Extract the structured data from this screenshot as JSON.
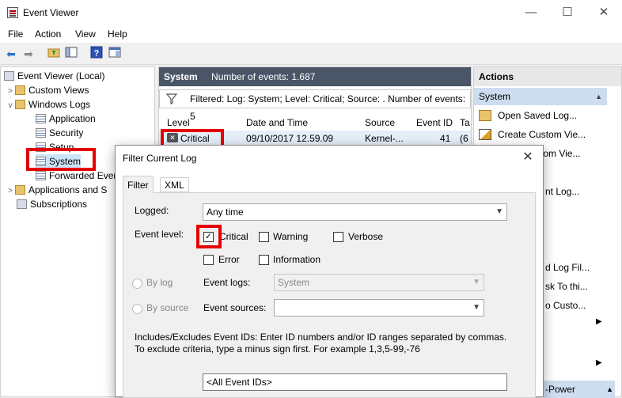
{
  "window": {
    "title": "Event Viewer",
    "minimize": "—",
    "maximize": "☐",
    "close": "✕"
  },
  "menu": [
    "File",
    "Action",
    "View",
    "Help"
  ],
  "toolbar": {
    "back": "back-arrow",
    "forward": "forward-arrow",
    "up": "folder-up",
    "show_hide": "show-hide-tree",
    "help": "help",
    "properties": "properties"
  },
  "tree": {
    "root": "Event Viewer (Local)",
    "custom_views": "Custom Views",
    "windows_logs": "Windows Logs",
    "application": "Application",
    "security": "Security",
    "setup": "Setup",
    "system": "System",
    "forwarded": "Forwarded Even",
    "apps_services": "Applications and S",
    "subscriptions": "Subscriptions"
  },
  "center": {
    "log_name": "System",
    "event_count": "Number of events: 1.687",
    "filter_text": "Filtered: Log: System; Level: Critical; Source: . Number of events: 5",
    "columns": [
      "Level",
      "Date and Time",
      "Source",
      "Event ID",
      "Ta"
    ],
    "row": {
      "level": "Critical",
      "date": "09/10/2017 12.59.09",
      "source": "Kernel-...",
      "event_id": "41",
      "task": "(6"
    }
  },
  "actions": {
    "header": "Actions",
    "section": "System",
    "items": [
      "Open Saved Log...",
      "Create Custom Vie...",
      "tom Vie...",
      "nt Log...",
      "d Log Fil...",
      "sk To thi...",
      "o Custo...",
      "-Power"
    ]
  },
  "dialog": {
    "title": "Filter Current Log",
    "close": "✕",
    "tabs": [
      "Filter",
      "XML"
    ],
    "logged_label": "Logged:",
    "logged_value": "Any time",
    "event_level_label": "Event level:",
    "levels": {
      "critical": "Critical",
      "warning": "Warning",
      "verbose": "Verbose",
      "error": "Error",
      "information": "Information"
    },
    "checked": {
      "critical": true,
      "warning": false,
      "verbose": false,
      "error": false,
      "information": false
    },
    "by_log": "By log",
    "by_source": "By source",
    "event_logs_label": "Event logs:",
    "event_logs_value": "System",
    "event_sources_label": "Event sources:",
    "event_sources_value": "",
    "includes_text": "Includes/Excludes Event IDs: Enter ID numbers and/or ID ranges separated by commas. To exclude criteria, type a minus sign first. For example 1,3,5-99,-76",
    "event_ids_value": "<All Event IDs>"
  }
}
